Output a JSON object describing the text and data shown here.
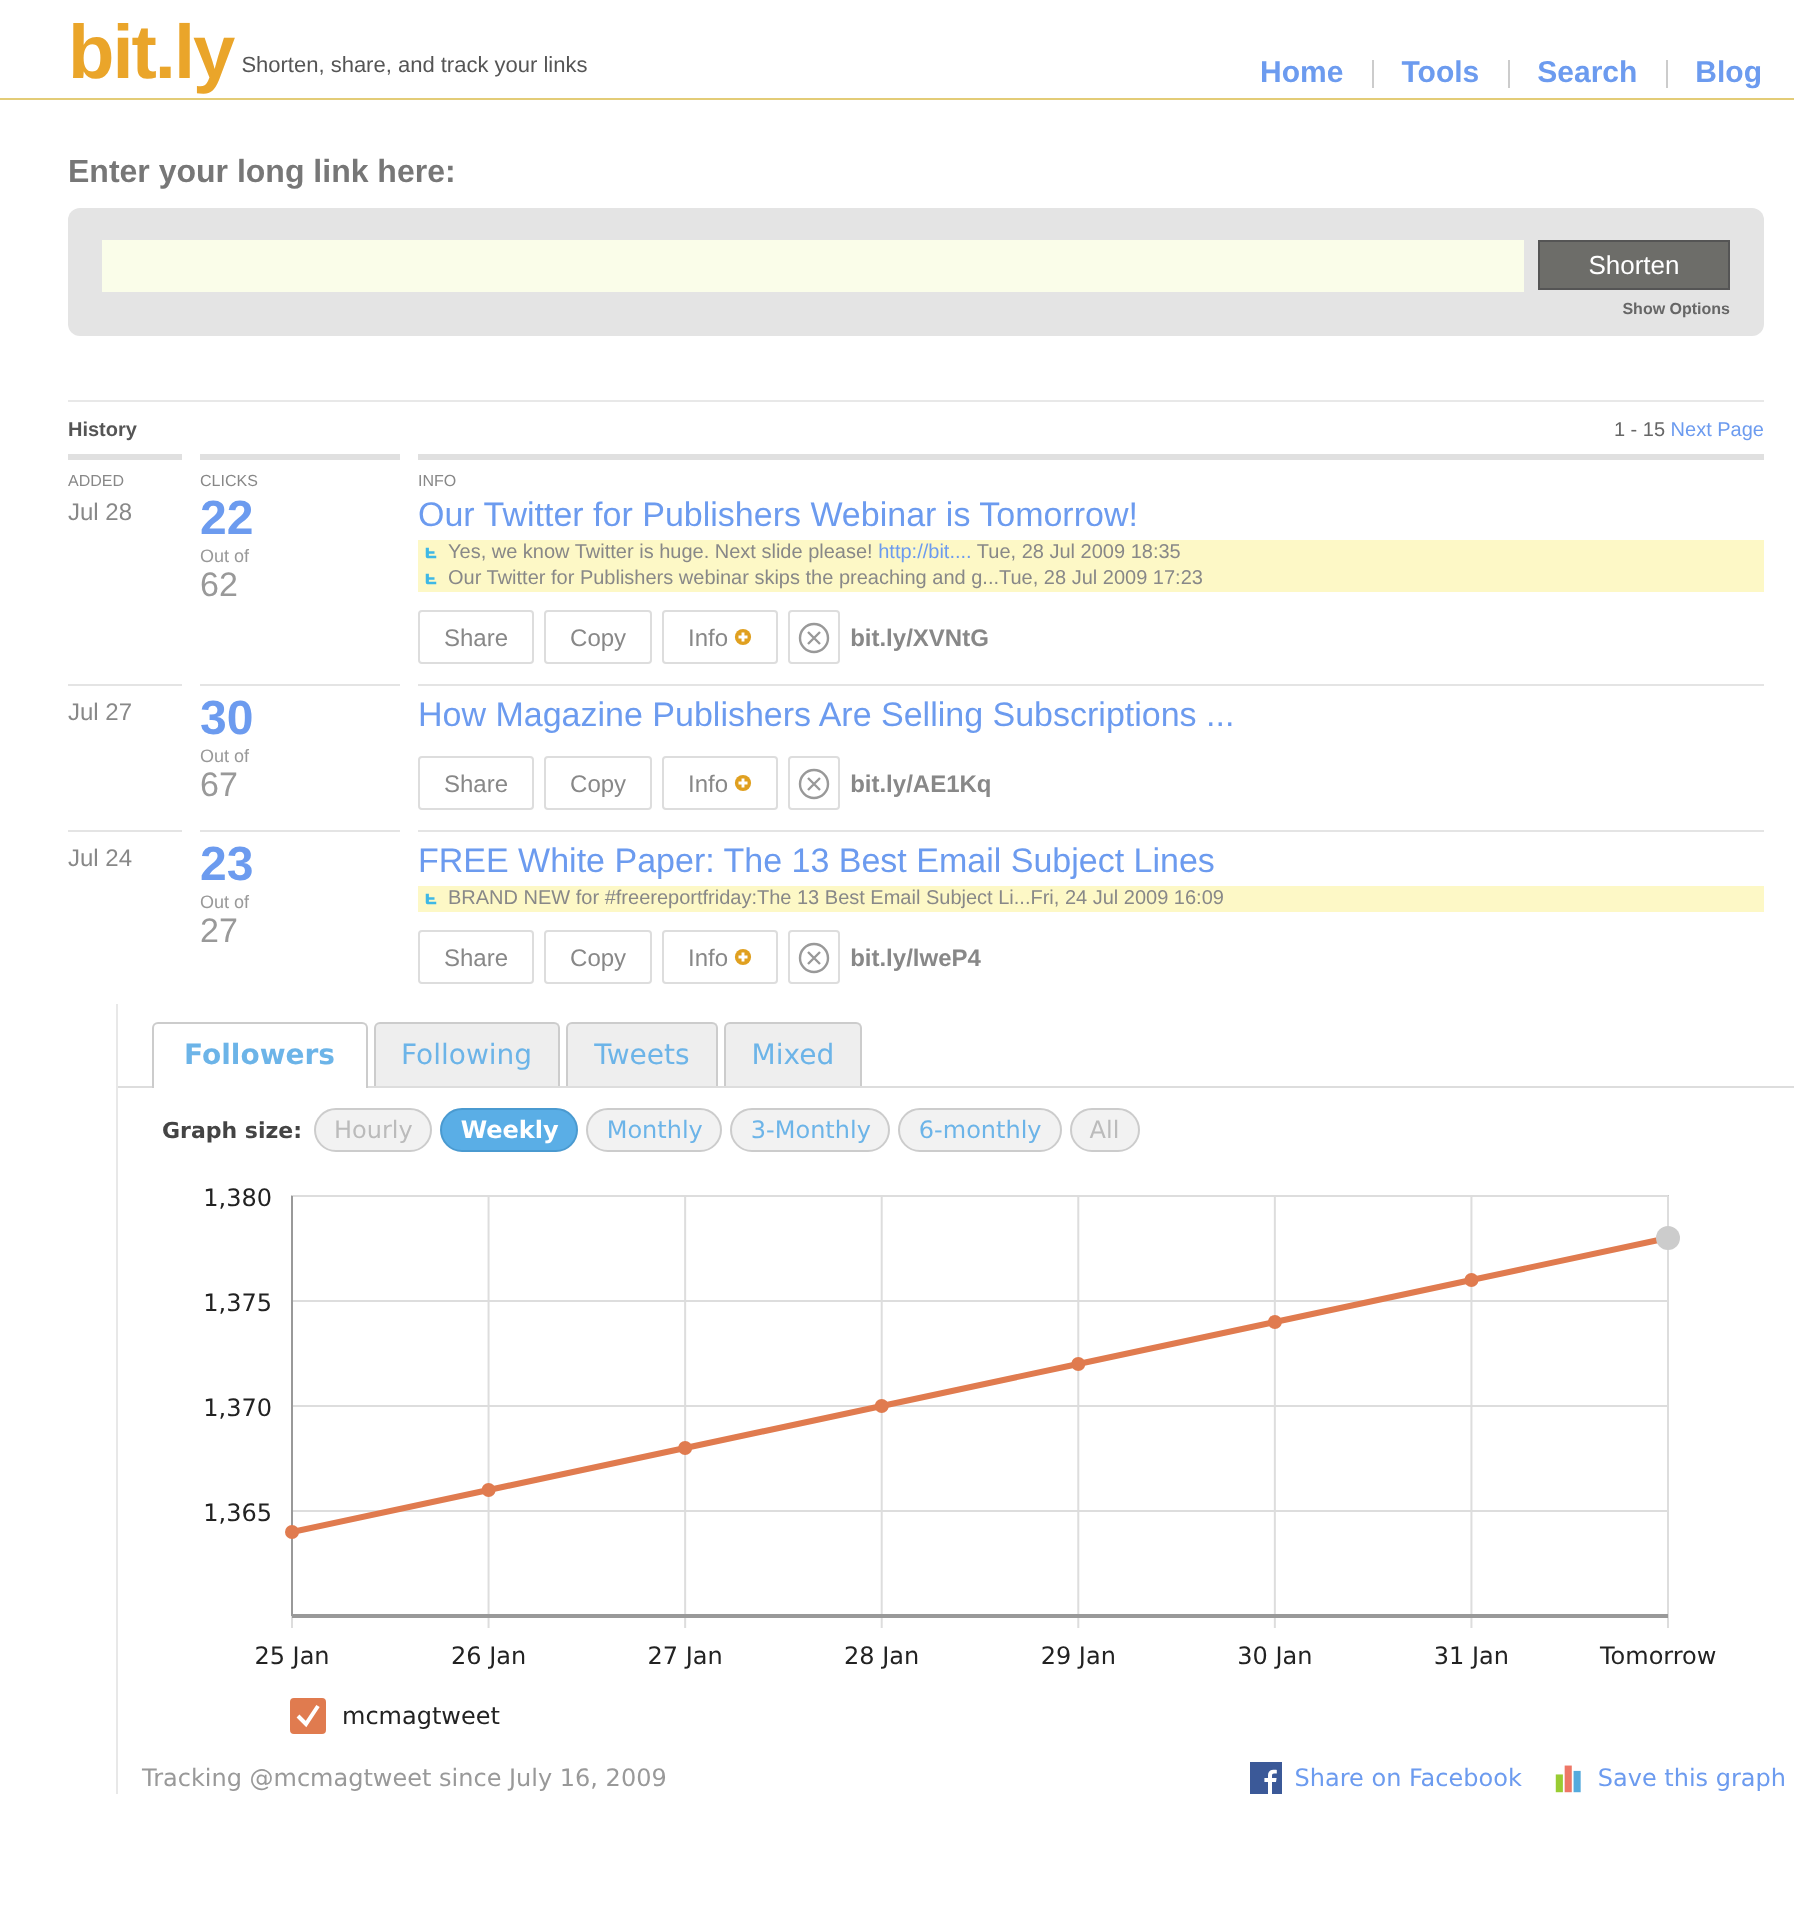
{
  "header": {
    "logo": "bit.ly",
    "tagline": "Shorten, share, and track your links",
    "nav": [
      "Home",
      "Tools",
      "Search",
      "Blog"
    ]
  },
  "shorten": {
    "label": "Enter your long link here:",
    "button": "Shorten",
    "options": "Show Options"
  },
  "history": {
    "title": "History",
    "range": "1 - 15",
    "next": "Next Page",
    "columns": [
      "ADDED",
      "CLICKS",
      "INFO"
    ],
    "rows": [
      {
        "added": "Jul 28",
        "clicks": "22",
        "out_of_label": "Out of",
        "out_of": "62",
        "title": "Our Twitter for Publishers Webinar is Tomorrow!",
        "tweets": [
          {
            "text": "Yes, we know Twitter is huge. Next slide please!",
            "link": "http://bit....",
            "time": "Tue, 28 Jul 2009 18:35"
          },
          {
            "text": "Our Twitter for Publishers webinar skips the preaching and g...Tue, 28 Jul 2009 17:23"
          }
        ],
        "actions": [
          "Share",
          "Copy",
          "Info"
        ],
        "short": "bit.ly/XVNtG"
      },
      {
        "added": "Jul 27",
        "clicks": "30",
        "out_of_label": "Out of",
        "out_of": "67",
        "title": "How Magazine Publishers Are Selling Subscriptions ...",
        "tweets": [],
        "actions": [
          "Share",
          "Copy",
          "Info"
        ],
        "short": "bit.ly/AE1Kq"
      },
      {
        "added": "Jul 24",
        "clicks": "23",
        "out_of_label": "Out of",
        "out_of": "27",
        "title": "FREE White Paper: The 13 Best Email Subject Lines",
        "tweets": [
          {
            "text": "BRAND NEW for #freereportfriday:The 13 Best Email Subject Li...Fri, 24 Jul 2009 16:09"
          }
        ],
        "actions": [
          "Share",
          "Copy",
          "Info"
        ],
        "short": "bit.ly/lweP4"
      }
    ]
  },
  "graph": {
    "tabs": [
      {
        "label": "Followers",
        "selected": true
      },
      {
        "label": "Following",
        "selected": false
      },
      {
        "label": "Tweets",
        "selected": false
      },
      {
        "label": "Mixed",
        "selected": false
      }
    ],
    "size_label": "Graph size:",
    "sizes": [
      {
        "label": "Hourly",
        "selected": false,
        "disabled": true
      },
      {
        "label": "Weekly",
        "selected": true,
        "disabled": false
      },
      {
        "label": "Monthly",
        "selected": false,
        "disabled": false
      },
      {
        "label": "3-Monthly",
        "selected": false,
        "disabled": false
      },
      {
        "label": "6-monthly",
        "selected": false,
        "disabled": false
      },
      {
        "label": "All",
        "selected": false,
        "disabled": true
      }
    ],
    "chart_data": {
      "type": "line",
      "categories": [
        "25 Jan",
        "26 Jan",
        "27 Jan",
        "28 Jan",
        "29 Jan",
        "30 Jan",
        "31 Jan",
        "Tomorrow"
      ],
      "series": [
        {
          "name": "mcmagtweet",
          "color": "#e07b4f",
          "marker": true,
          "values": [
            1364,
            1366,
            1368,
            1370,
            1372,
            1374,
            1376,
            1378
          ]
        }
      ],
      "ylim": [
        1360,
        1380
      ],
      "grid": true,
      "yticks": [
        {
          "value": 1365,
          "label": "1,365"
        },
        {
          "value": 1370,
          "label": "1,370"
        },
        {
          "value": 1375,
          "label": "1,375"
        },
        {
          "value": 1380,
          "label": "1,380"
        }
      ]
    },
    "legend_checked": true,
    "tracking": "Tracking @mcmagtweet since July 16, 2009",
    "facebook": "Share on Facebook",
    "save": "Save this graph"
  }
}
